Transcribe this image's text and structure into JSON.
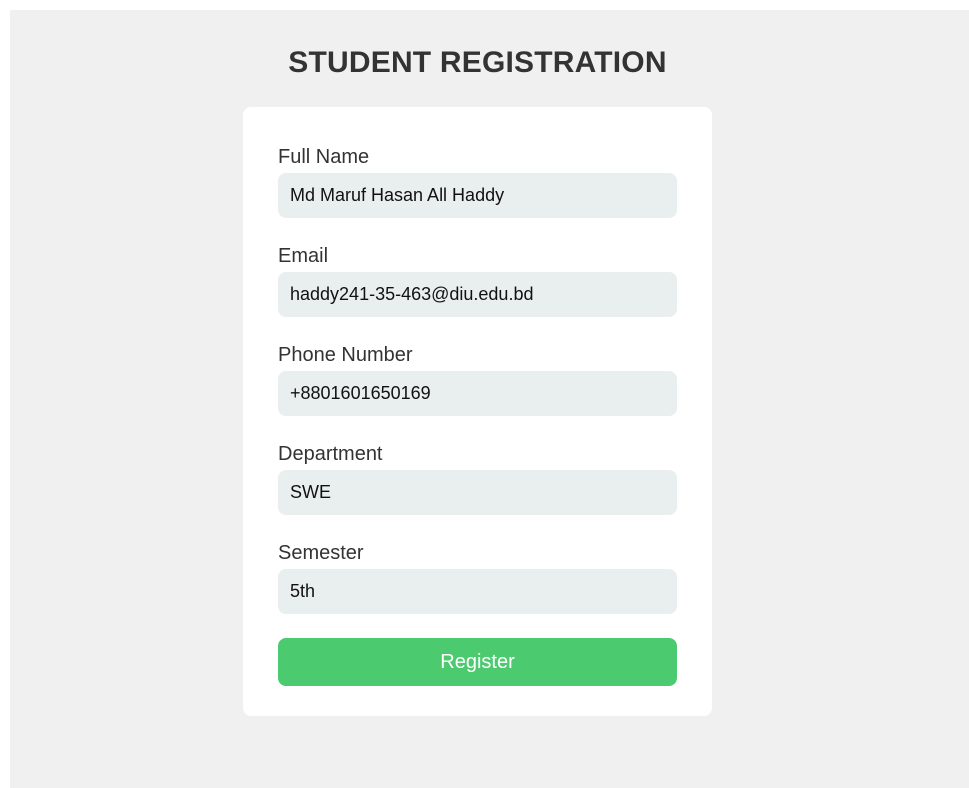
{
  "page": {
    "title": "STUDENT REGISTRATION"
  },
  "form": {
    "fields": [
      {
        "label": "Full Name",
        "value": "Md Maruf Hasan All Haddy"
      },
      {
        "label": "Email",
        "value": "haddy241-35-463@diu.edu.bd"
      },
      {
        "label": "Phone Number",
        "value": "+8801601650169"
      },
      {
        "label": "Department",
        "value": "SWE"
      },
      {
        "label": "Semester",
        "value": "5th"
      }
    ],
    "submit_label": "Register"
  },
  "colors": {
    "background": "#f0f0f0",
    "card": "#ffffff",
    "input_background": "#e9eeef",
    "button": "#4cca70",
    "text": "#333333"
  }
}
